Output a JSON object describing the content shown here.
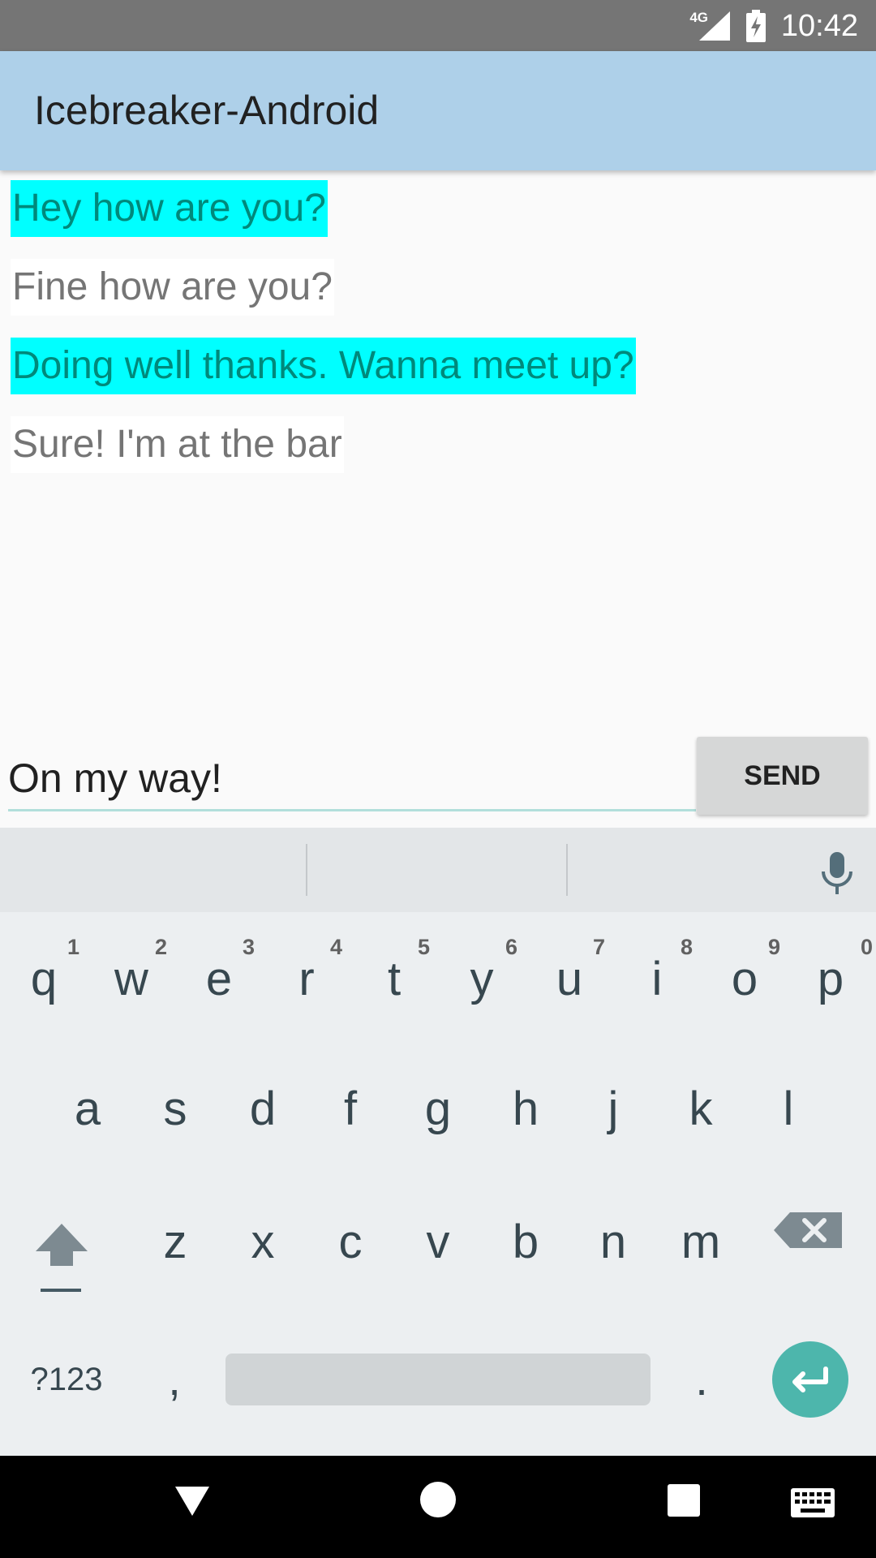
{
  "status_bar": {
    "network_label": "4G",
    "time": "10:42",
    "icons": [
      "signal-icon",
      "battery-charging-icon"
    ]
  },
  "app_bar": {
    "title": "Icebreaker-Android"
  },
  "messages": [
    {
      "text": "Hey how are you?",
      "sender": "me",
      "highlight": "#00FFFF"
    },
    {
      "text": "Fine how are you?",
      "sender": "them"
    },
    {
      "text": "Doing well thanks. Wanna meet up?",
      "sender": "me",
      "highlight": "#00FFFF"
    },
    {
      "text": "Sure! I'm at the bar",
      "sender": "them"
    }
  ],
  "composer": {
    "value": "On my way!",
    "send_label": "SEND"
  },
  "keyboard": {
    "row1": [
      {
        "label": "q",
        "hint": "1"
      },
      {
        "label": "w",
        "hint": "2"
      },
      {
        "label": "e",
        "hint": "3"
      },
      {
        "label": "r",
        "hint": "4"
      },
      {
        "label": "t",
        "hint": "5"
      },
      {
        "label": "y",
        "hint": "6"
      },
      {
        "label": "u",
        "hint": "7"
      },
      {
        "label": "i",
        "hint": "8"
      },
      {
        "label": "o",
        "hint": "9"
      },
      {
        "label": "p",
        "hint": "0"
      }
    ],
    "row2": [
      "a",
      "s",
      "d",
      "f",
      "g",
      "h",
      "j",
      "k",
      "l"
    ],
    "row3": [
      "z",
      "x",
      "c",
      "v",
      "b",
      "n",
      "m"
    ],
    "symbols_label": "?123",
    "comma_label": ",",
    "period_label": ".",
    "icons": [
      "mic-icon",
      "shift-icon",
      "backspace-icon",
      "enter-icon"
    ]
  },
  "nav_bar": {
    "icons": [
      "back-icon",
      "home-icon",
      "recents-icon",
      "keyboard-switch-icon"
    ]
  },
  "colors": {
    "status_bar": "#757575",
    "app_bar": "#AED0E9",
    "my_message_bg": "#00FFFF",
    "my_message_text": "#00897B",
    "their_message_text": "#757575",
    "send_button": "#D6D7D7",
    "keyboard_bg": "#ECEFF1",
    "enter_key": "#4DB6AC"
  }
}
